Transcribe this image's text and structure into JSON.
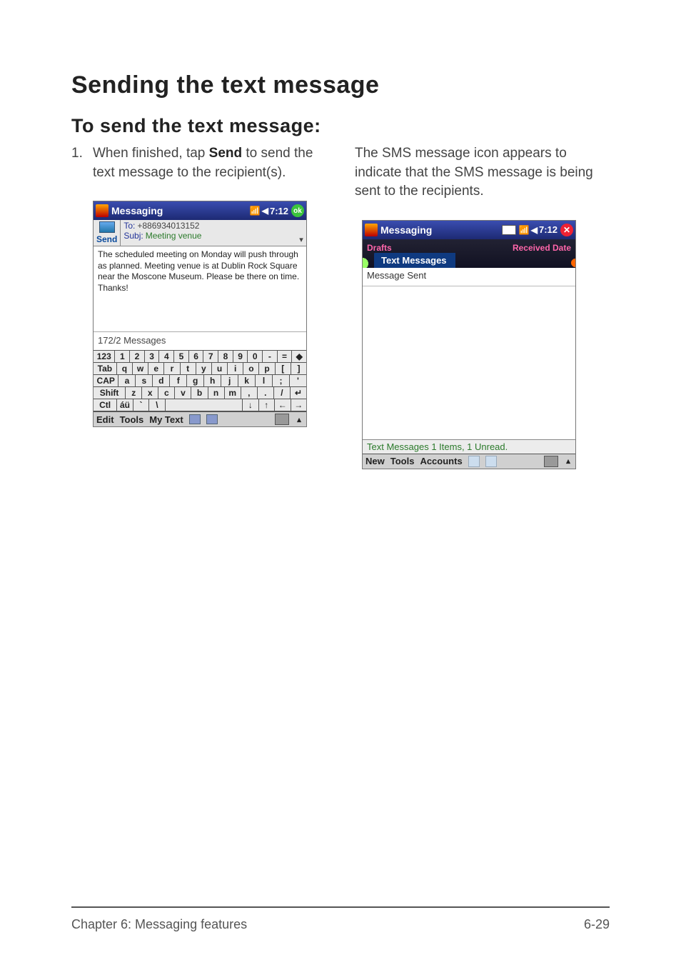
{
  "headings": {
    "h1": "Sending the text message",
    "h2": "To send the text message:"
  },
  "left": {
    "step_num": "1.",
    "step_text_prefix": "When finished, tap ",
    "step_bold": "Send",
    "step_text_suffix": " to send the text message to the recipient(s)."
  },
  "right": {
    "para": "The SMS message icon appears to indicate that the SMS message is being sent to the recipients."
  },
  "shot1": {
    "title": "Messaging",
    "time": "7:12",
    "ok": "ok",
    "to_label": "To:",
    "to_value": "+886934013152",
    "send": "Send",
    "subj_label": "Subj:",
    "subj_value": "Meeting venue",
    "body": "The scheduled meeting on Monday will push through as planned. Meeting venue is at Dublin Rock Square near the Moscone Museum. Please be there on time. Thanks!",
    "counter": "172/2 Messages",
    "kbd": {
      "r1": [
        "123",
        "1",
        "2",
        "3",
        "4",
        "5",
        "6",
        "7",
        "8",
        "9",
        "0",
        "-",
        "=",
        "◆"
      ],
      "r2": [
        "Tab",
        "q",
        "w",
        "e",
        "r",
        "t",
        "y",
        "u",
        "i",
        "o",
        "p",
        "[",
        "]"
      ],
      "r3": [
        "CAP",
        "a",
        "s",
        "d",
        "f",
        "g",
        "h",
        "j",
        "k",
        "l",
        ";",
        "'"
      ],
      "r4": [
        "Shift",
        "z",
        "x",
        "c",
        "v",
        "b",
        "n",
        "m",
        ",",
        ".",
        "/",
        "↵"
      ],
      "r5": [
        "Ctl",
        "áü",
        "`",
        "\\",
        "",
        "↓",
        "↑",
        "←",
        "→"
      ]
    },
    "menu": {
      "edit": "Edit",
      "tools": "Tools",
      "mytext": "My Text"
    }
  },
  "shot2": {
    "title": "Messaging",
    "time": "7:12",
    "drafts": "Drafts",
    "received": "Received Date",
    "tab": "Text Messages",
    "row": "Message Sent",
    "status": "Text Messages  1 Items, 1 Unread.",
    "menu": {
      "new": "New",
      "tools": "Tools",
      "accounts": "Accounts"
    }
  },
  "footer": {
    "left": "Chapter 6: Messaging features",
    "right": "6-29"
  }
}
